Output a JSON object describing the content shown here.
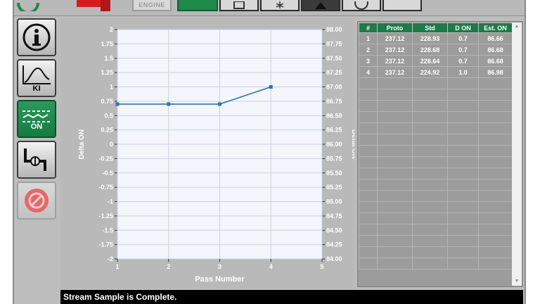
{
  "toolbar": {
    "engine_label": "ENGINE"
  },
  "sidebar": {
    "info_icon": "info-icon",
    "ki_label": "KI",
    "on_label": "ON",
    "valve_icon": "pipe-valve-icon",
    "stop_icon": "stop-icon"
  },
  "chart_data": {
    "type": "line",
    "xlabel": "Pass Number",
    "ylabel_left": "Delta ON",
    "ylabel_right": "Delta ON",
    "x_ticks": [
      "1",
      "2",
      "3",
      "4",
      "5"
    ],
    "y_left_ticks": [
      "2",
      "1.75",
      "1.5",
      "1.25",
      "1",
      "0.75",
      "0.5",
      "0.25",
      "0",
      "-0.25",
      "-0.5",
      "-0.75",
      "-1",
      "-1.25",
      "-1.5",
      "-1.75",
      "-2"
    ],
    "y_right_ticks": [
      "88.00",
      "87.75",
      "87.50",
      "87.25",
      "87.00",
      "86.75",
      "86.50",
      "86.25",
      "86.00",
      "85.75",
      "85.50",
      "85.25",
      "85.00",
      "84.75",
      "84.50",
      "84.25",
      "84.00"
    ],
    "xlim": [
      1,
      5
    ],
    "ylim": [
      -2,
      2
    ],
    "y2lim": [
      84,
      88
    ],
    "grid": true,
    "series": [
      {
        "x": [
          1,
          2,
          3,
          4
        ],
        "y": [
          0.7,
          0.7,
          0.7,
          1.0
        ],
        "color": "#2b72b8"
      }
    ]
  },
  "table": {
    "columns": [
      "#",
      "Proto",
      "Std",
      "D ON",
      "Est. ON"
    ],
    "rows": [
      [
        "1",
        "237.12",
        "228.93",
        "0.7",
        "86.66"
      ],
      [
        "2",
        "237.12",
        "228.68",
        "0.7",
        "86.68"
      ],
      [
        "3",
        "237.12",
        "228.64",
        "0.7",
        "86.68"
      ],
      [
        "4",
        "237.12",
        "224.92",
        "1.0",
        "86.98"
      ]
    ],
    "empty_rows": 17
  },
  "status": {
    "message": "Stream Sample is Complete."
  },
  "colors": {
    "accent": "#1f8a4c",
    "line": "#2b72b8",
    "header": "#1f7a4a"
  }
}
